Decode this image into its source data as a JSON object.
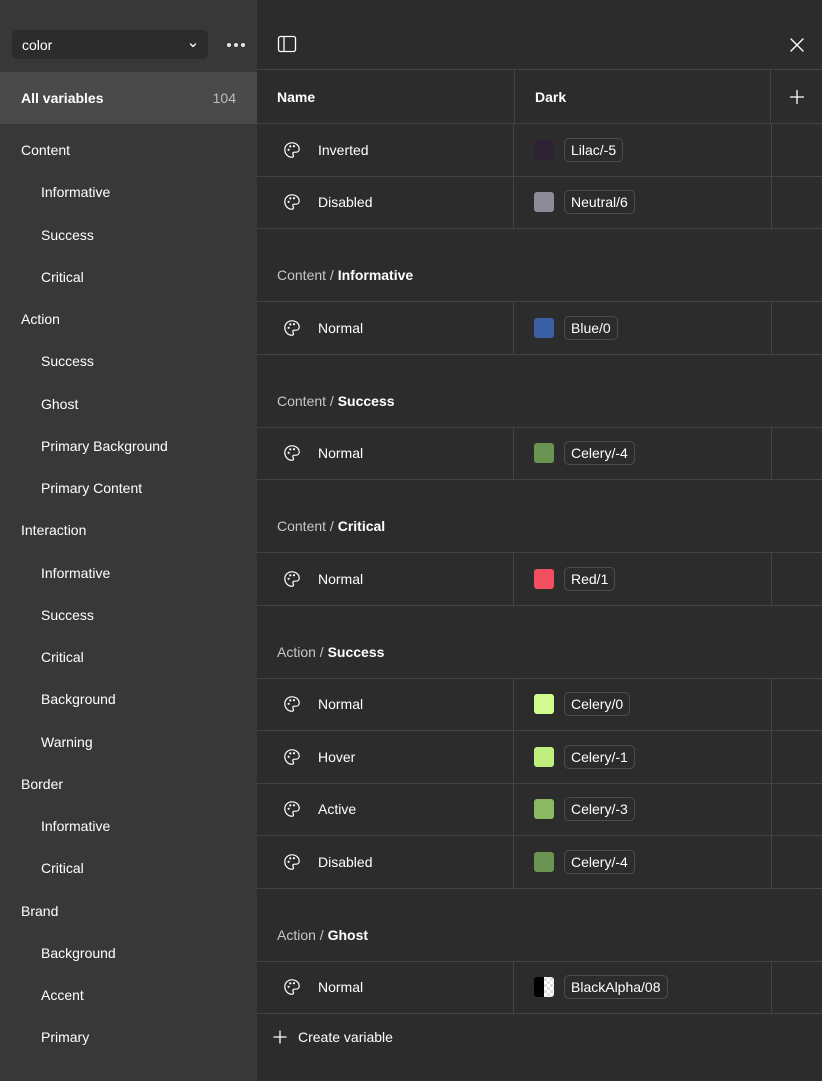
{
  "sidebar": {
    "collection_select": {
      "value": "color"
    },
    "all_variables": {
      "label": "All variables",
      "count": "104"
    },
    "groups": [
      {
        "label": "Content",
        "level": 0
      },
      {
        "label": "Informative",
        "level": 1
      },
      {
        "label": "Success",
        "level": 1
      },
      {
        "label": "Critical",
        "level": 1
      },
      {
        "label": "Action",
        "level": 0
      },
      {
        "label": "Success",
        "level": 1
      },
      {
        "label": "Ghost",
        "level": 1
      },
      {
        "label": "Primary Background",
        "level": 1
      },
      {
        "label": "Primary Content",
        "level": 1
      },
      {
        "label": "Interaction",
        "level": 0
      },
      {
        "label": "Informative",
        "level": 1
      },
      {
        "label": "Success",
        "level": 1
      },
      {
        "label": "Critical",
        "level": 1
      },
      {
        "label": "Background",
        "level": 1
      },
      {
        "label": "Warning",
        "level": 1
      },
      {
        "label": "Border",
        "level": 0
      },
      {
        "label": "Informative",
        "level": 1
      },
      {
        "label": "Critical",
        "level": 1
      },
      {
        "label": "Brand",
        "level": 0
      },
      {
        "label": "Background",
        "level": 1
      },
      {
        "label": "Accent",
        "level": 1
      },
      {
        "label": "Primary",
        "level": 1
      }
    ]
  },
  "table": {
    "columns": {
      "name": "Name",
      "mode": "Dark"
    },
    "sections": [
      {
        "items": [
          {
            "name": "Inverted",
            "value": "Lilac/-5",
            "color": "#2c2233"
          },
          {
            "name": "Disabled",
            "value": "Neutral/6",
            "color": "#8e8a96"
          }
        ]
      },
      {
        "path": "Content /",
        "group": "Informative",
        "items": [
          {
            "name": "Normal",
            "value": "Blue/0",
            "color": "#3b5fa6"
          }
        ]
      },
      {
        "path": "Content /",
        "group": "Success",
        "items": [
          {
            "name": "Normal",
            "value": "Celery/-4",
            "color": "#6b9450"
          }
        ]
      },
      {
        "path": "Content /",
        "group": "Critical",
        "items": [
          {
            "name": "Normal",
            "value": "Red/1",
            "color": "#f2505e"
          }
        ]
      },
      {
        "path": "Action /",
        "group": "Success",
        "items": [
          {
            "name": "Normal",
            "value": "Celery/0",
            "color": "#d2fc8d"
          },
          {
            "name": "Hover",
            "value": "Celery/-1",
            "color": "#c1ef7d"
          },
          {
            "name": "Active",
            "value": "Celery/-3",
            "color": "#8cb864"
          },
          {
            "name": "Disabled",
            "value": "Celery/-4",
            "color": "#6b9450"
          }
        ]
      },
      {
        "path": "Action /",
        "group": "Ghost",
        "items": [
          {
            "name": "Normal",
            "value": "BlackAlpha/08",
            "color": "checker"
          }
        ]
      }
    ],
    "create_label": "Create variable"
  },
  "colors": {
    "sidebar_bg": "#383838",
    "main_bg": "#2c2c2c",
    "selected_bg": "#4a4a4a",
    "divider": "#444444"
  },
  "icons": {
    "row_icon": "palette-icon",
    "panel": "sidebar-toggle-icon",
    "close": "close-icon",
    "add": "plus-icon",
    "more": "more-horizontal-icon",
    "dropdown": "chevron-down-icon"
  }
}
